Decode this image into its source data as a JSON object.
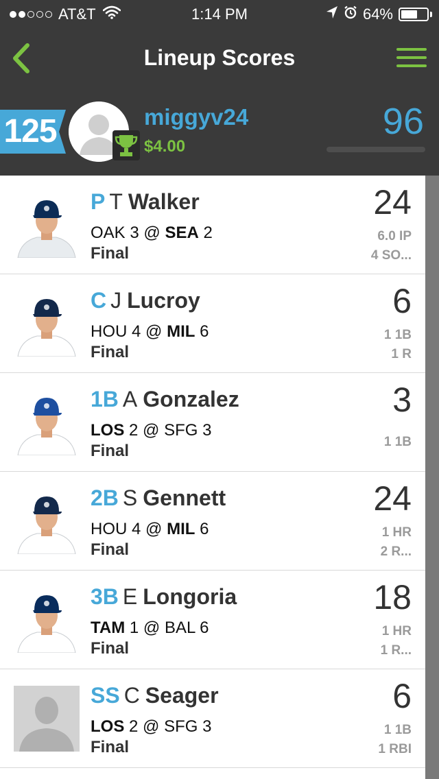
{
  "status_bar": {
    "carrier": "AT&T",
    "time": "1:14 PM",
    "battery": "64%",
    "battery_level": 0.64,
    "signal_bars": 2
  },
  "nav": {
    "title": "Lineup Scores",
    "back_icon": "chevron-left-icon",
    "menu_icon": "hamburger-menu-icon"
  },
  "header": {
    "rank": "125",
    "username": "miggyv24",
    "winnings": "$4.00",
    "score": "96"
  },
  "colors": {
    "accent_blue": "#47a8d8",
    "accent_green": "#7cc242",
    "header_bg": "#3a3a3a"
  },
  "players": [
    {
      "pos": "P",
      "initial": "T",
      "last": "Walker",
      "away": "OAK",
      "away_score": "3",
      "at": "@",
      "home": "SEA",
      "home_score": "2",
      "bold": "home",
      "status": "Final",
      "points": "24",
      "stat1": "6.0 IP",
      "stat2": "4 SO...",
      "jersey": "#e8ecef",
      "cap": "#0c2c56"
    },
    {
      "pos": "C",
      "initial": "J",
      "last": "Lucroy",
      "away": "HOU",
      "away_score": "4",
      "at": "@",
      "home": "MIL",
      "home_score": "6",
      "bold": "home",
      "status": "Final",
      "points": "6",
      "stat1": "1 1B",
      "stat2": "1 R",
      "jersey": "#ffffff",
      "cap": "#13294b"
    },
    {
      "pos": "1B",
      "initial": "A",
      "last": "Gonzalez",
      "away": "LOS",
      "away_score": "2",
      "at": "@",
      "home": "SFG",
      "home_score": "3",
      "bold": "away",
      "status": "Final",
      "points": "3",
      "stat1": "1 1B",
      "stat2": "",
      "jersey": "#ffffff",
      "cap": "#1e4fa0"
    },
    {
      "pos": "2B",
      "initial": "S",
      "last": "Gennett",
      "away": "HOU",
      "away_score": "4",
      "at": "@",
      "home": "MIL",
      "home_score": "6",
      "bold": "home",
      "status": "Final",
      "points": "24",
      "stat1": "1 HR",
      "stat2": "2 R...",
      "jersey": "#ffffff",
      "cap": "#13294b"
    },
    {
      "pos": "3B",
      "initial": "E",
      "last": "Longoria",
      "away": "TAM",
      "away_score": "1",
      "at": "@",
      "home": "BAL",
      "home_score": "6",
      "bold": "away",
      "status": "Final",
      "points": "18",
      "stat1": "1 HR",
      "stat2": "1 R...",
      "jersey": "#ffffff",
      "cap": "#092c5c"
    },
    {
      "pos": "SS",
      "initial": "C",
      "last": "Seager",
      "away": "LOS",
      "away_score": "2",
      "at": "@",
      "home": "SFG",
      "home_score": "3",
      "bold": "away",
      "status": "Final",
      "points": "6",
      "stat1": "1 1B",
      "stat2": "1 RBI",
      "jersey": "",
      "cap": ""
    }
  ]
}
